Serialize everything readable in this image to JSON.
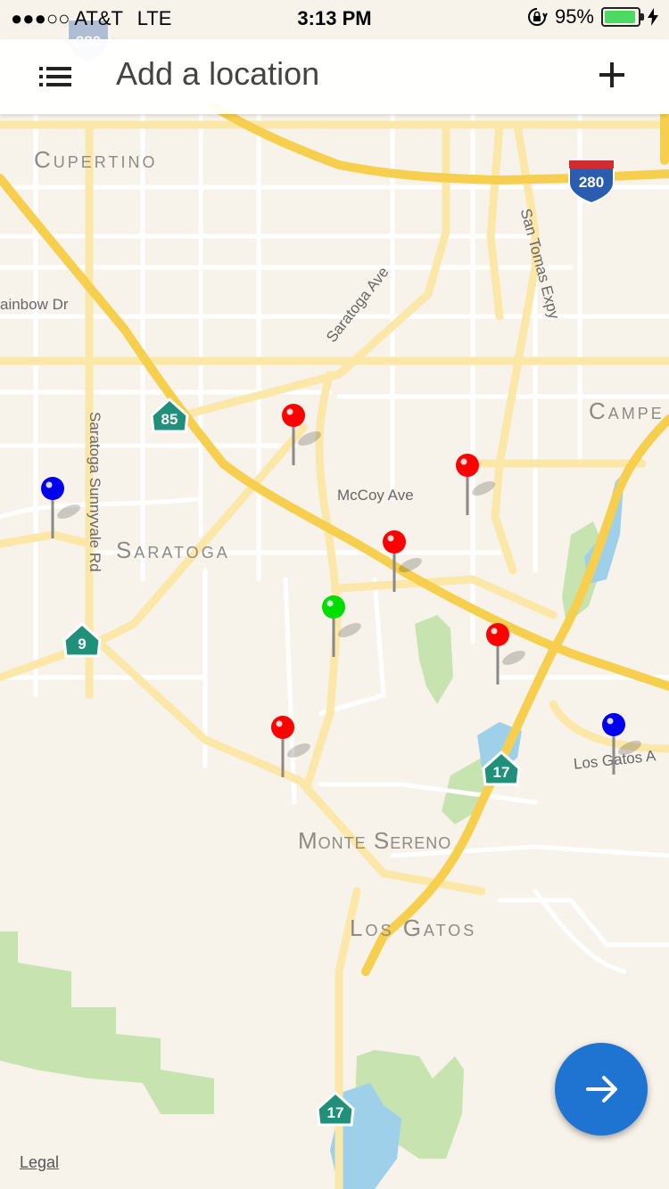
{
  "status_bar": {
    "carrier": "AT&T",
    "signal_dots": "●●●○○",
    "network": "LTE",
    "time": "3:13 PM",
    "battery": "95%",
    "battery_level": 0.95
  },
  "search": {
    "text": "Add a location"
  },
  "map": {
    "legal": "Legal",
    "cities": [
      "Cupertino",
      "Saratoga",
      "Campe",
      "Monte Sereno",
      "Los Gatos"
    ],
    "streets": [
      "Saratoga Ave",
      "San Tomas Expy",
      "ainbow Dr",
      "McCoy Ave",
      "Saratoga Sunnyvale Rd",
      "Los Gatos A"
    ],
    "shields": [
      "280",
      "280",
      "85",
      "9",
      "17",
      "17"
    ],
    "pins": [
      {
        "color": "#ff0000",
        "name": "red"
      },
      {
        "color": "#ff0000",
        "name": "red"
      },
      {
        "color": "#ff0000",
        "name": "red"
      },
      {
        "color": "#ff0000",
        "name": "red"
      },
      {
        "color": "#ff0000",
        "name": "red"
      },
      {
        "color": "#00dd00",
        "name": "green"
      },
      {
        "color": "#0000ee",
        "name": "blue"
      },
      {
        "color": "#0000ee",
        "name": "blue"
      }
    ]
  },
  "icons": {
    "menu": "list-icon",
    "add": "plus-icon",
    "next": "arrow-right-icon",
    "lock": "lock-rotation-icon",
    "charging": "bolt-icon"
  },
  "colors": {
    "accent": "#1e74d0",
    "highway": "#f7cf4f",
    "water": "#9fd0ea",
    "park": "#c6e3b0",
    "battery": "#4cd964"
  }
}
